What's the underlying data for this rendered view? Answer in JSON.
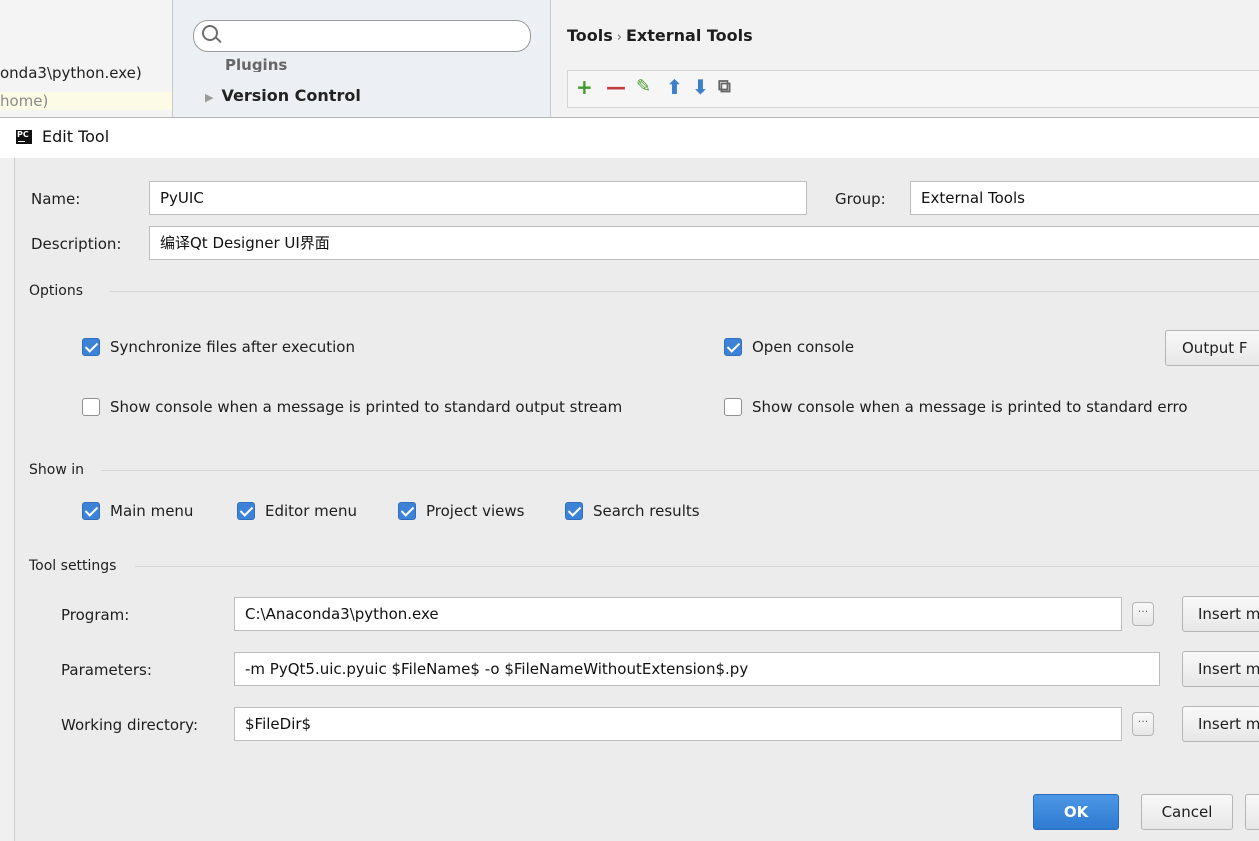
{
  "background": {
    "history_line_1": "onda3\\python.exe)",
    "history_line_2": "home)",
    "settings_tree": {
      "plugins_label": "Plugins",
      "version_control_label": "Version Control"
    },
    "breadcrumb": {
      "part1": "Tools",
      "separator": "›",
      "part2": "External Tools"
    },
    "toolbar": {
      "add": "+",
      "remove": "—",
      "edit": "✎",
      "move_up": "⬆",
      "move_down": "⬇",
      "copy": "⧉"
    }
  },
  "dialog": {
    "title": "Edit Tool",
    "logo_text": "PC",
    "name_label": "Name:",
    "name_value": "PyUIC",
    "group_label": "Group:",
    "group_value": "External Tools",
    "description_label": "Description:",
    "description_value": "编译Qt Designer UI界面",
    "options": {
      "title": "Options",
      "sync_files": {
        "label": "Synchronize files after execution",
        "checked": true
      },
      "open_console": {
        "label": "Open console",
        "checked": true
      },
      "output_filters_button": "Output F",
      "show_console_stdout": {
        "label": "Show console when a message is printed to standard output stream",
        "checked": false
      },
      "show_console_stderr": {
        "label": "Show console when a message is printed to standard erro",
        "checked": false
      }
    },
    "show_in": {
      "title": "Show in",
      "main_menu": {
        "label": "Main menu",
        "checked": true
      },
      "editor_menu": {
        "label": "Editor menu",
        "checked": true
      },
      "project_views": {
        "label": "Project views",
        "checked": true
      },
      "search_results": {
        "label": "Search results",
        "checked": true
      }
    },
    "tool_settings": {
      "title": "Tool settings",
      "program_label": "Program:",
      "program_value": "C:\\Anaconda3\\python.exe",
      "parameters_label": "Parameters:",
      "parameters_value": "-m PyQt5.uic.pyuic  $FileName$ -o $FileNameWithoutExtension$.py",
      "working_dir_label": "Working directory:",
      "working_dir_value": "$FileDir$",
      "browse_button": "···",
      "insert_macro_button": "Insert m"
    },
    "ok_button": "OK",
    "cancel_button": "Cancel"
  },
  "colors": {
    "accent": "#3c82d6",
    "add_green": "#3e9a2c",
    "remove_red": "#c43d3d"
  }
}
